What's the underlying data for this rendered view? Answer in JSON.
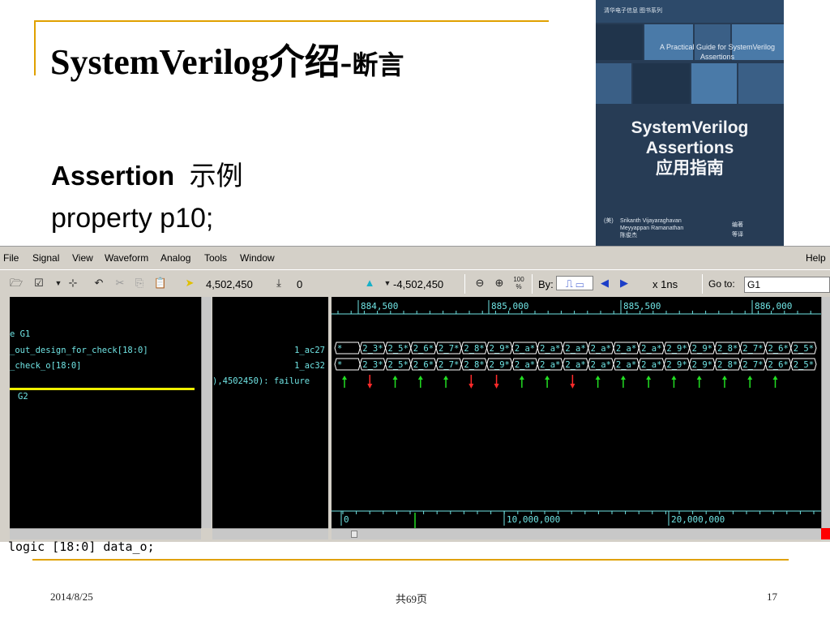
{
  "slide": {
    "title_main": "SystemVerilog介绍-",
    "title_sub": "断言",
    "bullet_bold": "Assertion",
    "bullet_rest": "示例",
    "code_top": "property p10;",
    "code_bottom": "logic [18:0] data_o;"
  },
  "book": {
    "publisher": "清华电子信息 图书系列",
    "english_title": "A Practical Guide for SystemVerilog Assertions",
    "title_lines": [
      "SystemVerilog",
      "Assertions",
      "应用指南"
    ],
    "author_prefix": "(美)",
    "authors": [
      "Srikanth Vijayaraghavan",
      "Meyyappan Ramanathan",
      "陈俊杰"
    ],
    "roles": [
      "编著",
      "等译"
    ]
  },
  "waveform": {
    "menu": [
      "File",
      "Signal",
      "View",
      "Waveform",
      "Analog",
      "Tools",
      "Window",
      "Help"
    ],
    "cursor_time": "4,502,450",
    "marker_value": "0",
    "delta": "-4,502,450",
    "zoom_label": "100 %",
    "by_label": "By:",
    "unit": "x 1ns",
    "goto_label": "Go to:",
    "goto_value": "G1",
    "signals": [
      "e G1",
      "_out_design_for_check[18:0]",
      "_check_o[18:0]",
      "G2"
    ],
    "values": [
      "1_ac27",
      "1_ac32",
      "),4502450): failure"
    ],
    "time_ticks_top": [
      "884,500",
      "885,000",
      "885,500",
      "886,000"
    ],
    "time_ticks_bottom": [
      "0",
      "10,000,000",
      "20,000,000"
    ],
    "bus1": [
      "*",
      "2_3*",
      "2_5*",
      "2_6*",
      "2_7*",
      "2_8*",
      "2_9*",
      "2_a*",
      "2_a*",
      "2_a*",
      "2_a*",
      "2_a*",
      "2_a*",
      "2_9*",
      "2_9*",
      "2_8*",
      "2_7*",
      "2_6*",
      "2_5*"
    ],
    "bus2": [
      "*",
      "2_3*",
      "2_5*",
      "2_6*",
      "2_7*",
      "2_8*",
      "2_9*",
      "2_a*",
      "2_a*",
      "2_a*",
      "2_a*",
      "2_a*",
      "2_a*",
      "2_9*",
      "2_9*",
      "2_8*",
      "2_7*",
      "2_6*",
      "2_5*"
    ],
    "assertion_results": [
      "pass",
      "fail",
      "pass",
      "pass",
      "pass",
      "fail",
      "fail",
      "pass",
      "pass",
      "fail",
      "pass",
      "pass",
      "pass",
      "pass",
      "pass",
      "pass",
      "pass",
      "pass"
    ],
    "colors": {
      "bus": "#6fe3e3",
      "pass": "#22dd22",
      "fail": "#ff2a2a",
      "grid": "#6fe3e3",
      "divider": "#f0f000",
      "bg": "#000000"
    }
  },
  "footer": {
    "date": "2014/8/25",
    "pages": "共69页",
    "page_number": "17"
  }
}
